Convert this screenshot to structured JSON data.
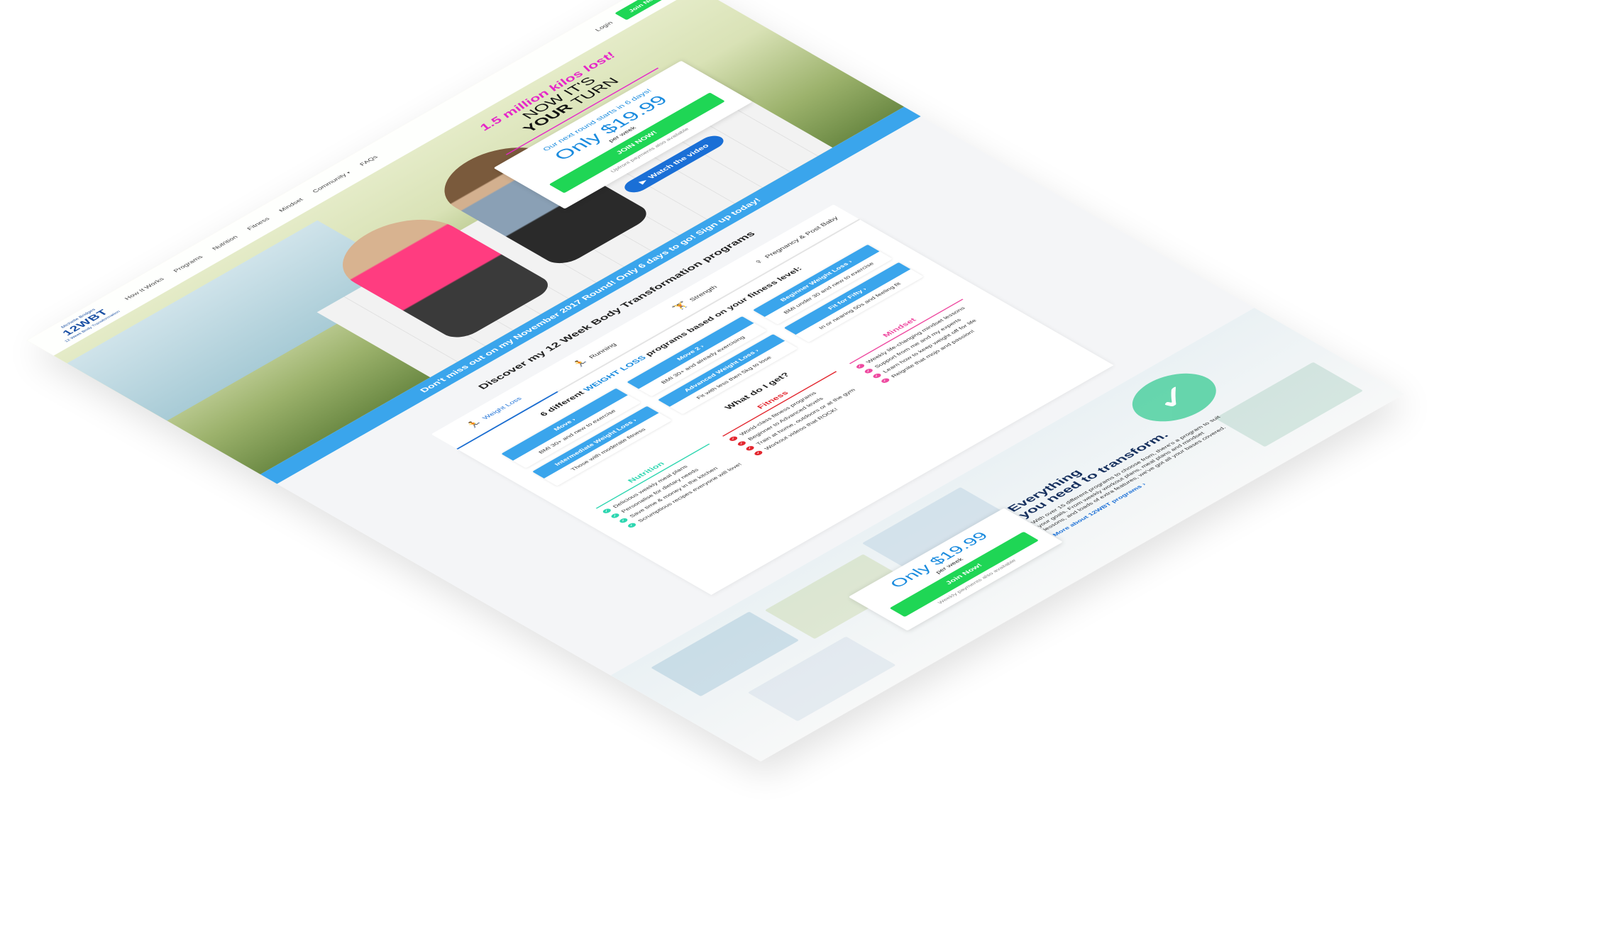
{
  "header": {
    "logo_top": "Michelle Bridges",
    "logo_main": "12WBT",
    "logo_bottom": "12 Week Body Transformation",
    "nav": [
      "How It Works",
      "Programs",
      "Nutrition",
      "Fitness",
      "Mindset",
      "Community",
      "FAQs"
    ],
    "login": "Login",
    "join": "Join Now"
  },
  "hero": {
    "kilos": "1.5 million kilos lost!",
    "turn_line1": "NOW IT'S",
    "turn_bold": "YOUR",
    "turn_line2": "TURN",
    "next_round": "Our next round starts in 6 days!",
    "price": "Only $19.99",
    "per_week": "per week",
    "join_now": "JOIN NOW!",
    "upfront": "Upfront payments also available",
    "watch": "Watch the video"
  },
  "banner": "Don't miss out on my November 2017 Round! Only 6 days to go! Sign up today!",
  "discover": {
    "title": "Discover my 12 Week Body Transformation programs",
    "tabs": [
      {
        "label": "Weight Loss",
        "icon": "weight-loss-icon"
      },
      {
        "label": "Running",
        "icon": "running-icon"
      },
      {
        "label": "Strength",
        "icon": "strength-icon"
      },
      {
        "label": "Pregnancy & Post Baby",
        "icon": "pregnancy-icon"
      }
    ],
    "sub_prefix": "6 different",
    "sub_highlight": "WEIGHT LOSS",
    "sub_suffix": "programs based on your fitness level:",
    "programs": [
      {
        "title": "Move ›",
        "desc": "BMI 30+ and new to exercise"
      },
      {
        "title": "Move 2 ›",
        "desc": "BMI 30+ and already exercising"
      },
      {
        "title": "Beginner Weight Loss ›",
        "desc": "BMI under 30 and new to exercise"
      },
      {
        "title": "Intermediate Weight Loss ›",
        "desc": "Those with moderate fitness"
      },
      {
        "title": "Advanced Weight Loss ›",
        "desc": "Fit with less then 5kg to lose"
      },
      {
        "title": "Fit for Fifty ›",
        "desc": "In or nearing 50s and feeling fit"
      }
    ],
    "what_title": "What do I get?",
    "nutrition": {
      "title": "Nutrition",
      "items": [
        "Delicious weekly meal plans",
        "Personalise for dietary needs",
        "Save time & money in the kitchen",
        "Scrumptious recipes everyone will love!"
      ]
    },
    "fitness": {
      "title": "Fitness",
      "items": [
        "World-class fitness programs",
        "Beginner to Advanced levels",
        "Train at home, outdoors or at the gym",
        "Workout videos that ROCK!"
      ]
    },
    "mindset": {
      "title": "Mindset",
      "items": [
        "Weekly life-changing mindset lessons",
        "Support from me and my experts",
        "Learn how to keep weight off for life",
        "Reignite that mojo and passion!"
      ]
    }
  },
  "everything": {
    "title_line1": "Everything",
    "title_line2": "you need to transform.",
    "desc": "With over 15 different programs to choose from, there's a program to suit your goals. From weekly workout plans, meal plans and mindset lessons, and loads of extra features, we've got all your bases covered.",
    "link": "More about 12WBT programs ›",
    "price": "Only $19.99",
    "per_week": "per week",
    "join": "Join Now!",
    "weekly": "Weekly payments also available"
  },
  "colors": {
    "accent_blue": "#3aa5ec",
    "brand_green": "#1fd655",
    "magenta": "#e526c8",
    "nutrition": "#2dd6b0",
    "fitness": "#e3272f",
    "mindset": "#ee4aa0"
  }
}
